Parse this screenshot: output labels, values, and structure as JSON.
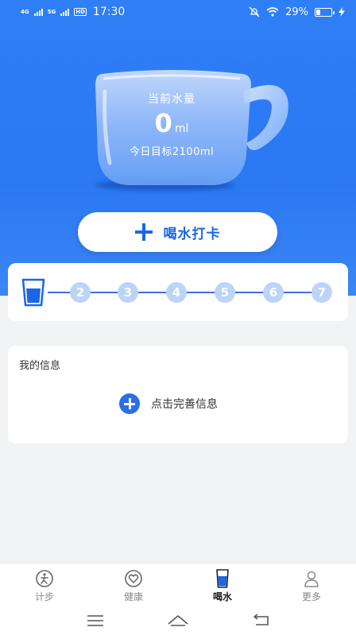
{
  "status_bar": {
    "net1": "4G",
    "net2": "5G",
    "hd": "HD",
    "time": "17:30",
    "battery": "29%"
  },
  "hero": {
    "current_label": "当前水量",
    "current_value": "0",
    "current_unit": "ml",
    "target_text": "今日目标2100ml"
  },
  "checkin_button": {
    "label": "喝水打卡"
  },
  "progress": {
    "steps": [
      "2",
      "3",
      "4",
      "5",
      "6",
      "7"
    ]
  },
  "info": {
    "title": "我的信息",
    "action": "点击完善信息"
  },
  "tabbar": {
    "tabs": [
      {
        "label": "计步",
        "icon": "walk-icon"
      },
      {
        "label": "健康",
        "icon": "heart-icon"
      },
      {
        "label": "喝水",
        "icon": "water-cup-icon"
      },
      {
        "label": "更多",
        "icon": "person-icon"
      }
    ]
  },
  "colors": {
    "primary": "#2f7ff7",
    "accent": "#1a66e6",
    "step_inactive": "#bcd4f7"
  }
}
